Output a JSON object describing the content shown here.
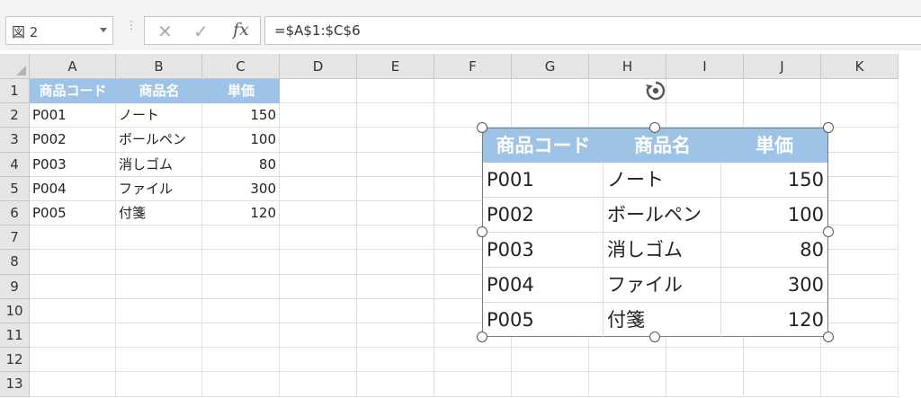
{
  "formula_bar": {
    "name_box": "図 2",
    "formula": "=$A$1:$C$6",
    "icons": [
      "cancel-icon",
      "enter-icon",
      "fx-icon"
    ]
  },
  "columns": [
    "A",
    "B",
    "C",
    "D",
    "E",
    "F",
    "G",
    "H",
    "I",
    "J",
    "K"
  ],
  "rows": [
    "1",
    "2",
    "3",
    "4",
    "5",
    "6",
    "7",
    "8",
    "9",
    "10",
    "11",
    "12",
    "13"
  ],
  "table": {
    "headers": [
      "商品コード",
      "商品名",
      "単価"
    ],
    "rows": [
      [
        "P001",
        "ノート",
        "150"
      ],
      [
        "P002",
        "ボールペン",
        "100"
      ],
      [
        "P003",
        "消しゴム",
        "80"
      ],
      [
        "P004",
        "ファイル",
        "300"
      ],
      [
        "P005",
        "付箋",
        "120"
      ]
    ]
  },
  "picture": {
    "headers": [
      "商品コード",
      "商品名",
      "単価"
    ],
    "rows": [
      [
        "P001",
        "ノート",
        "150"
      ],
      [
        "P002",
        "ボールペン",
        "100"
      ],
      [
        "P003",
        "消しゴム",
        "80"
      ],
      [
        "P004",
        "ファイル",
        "300"
      ],
      [
        "P005",
        "付箋",
        "120"
      ]
    ]
  },
  "colors": {
    "header_fill": "#9dc3e6",
    "header_text": "#ffffff"
  }
}
